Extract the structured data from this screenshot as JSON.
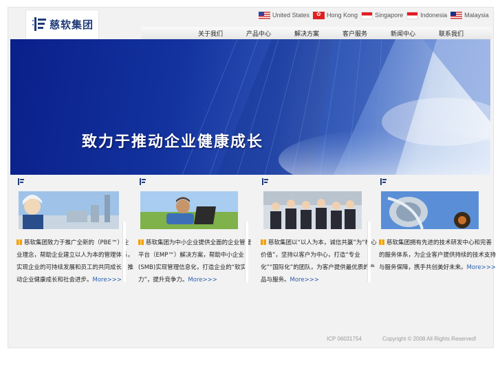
{
  "header": {
    "logo_text": "慈软集团",
    "countries": [
      {
        "label": "United States",
        "flag": "us-flag-icon"
      },
      {
        "label": "Hong Kong",
        "flag": "hk-flag-icon"
      },
      {
        "label": "Singapore",
        "flag": "sg-flag-icon"
      },
      {
        "label": "Indonesia",
        "flag": "id-flag-icon"
      },
      {
        "label": "Malaysia",
        "flag": "my-flag-icon"
      }
    ]
  },
  "nav": {
    "items": [
      "关于我们",
      "产品中心",
      "解决方案",
      "客户服务",
      "新闻中心",
      "联系我们"
    ]
  },
  "banner": {
    "slogan": "致力于推动企业健康成长"
  },
  "columns": [
    {
      "text": "慈软集团致力于推广全新的（PBE™）企业理念，帮助企业建立以人为本的管理体系，实现企业的可持续发展和员工的共同成长，推动企业健康成长和社会进步。",
      "more": "More>>>"
    },
    {
      "text": "慈软集团为中小企业提供全面的企业管理平台（EMP™）解决方案，帮助中小企业(SMB)实现管理信息化，打造企业的“软实力”，提升竞争力。",
      "more": "More>>>"
    },
    {
      "text": "慈软集团以“以人为本，诚信共赢”为“核心价值”，坚持以客户为中心，打造“专业化”“国际化”的团队，为客户提供最优质的产品与服务。",
      "more": "More>>>"
    },
    {
      "text": "慈软集团拥有先进的技术研发中心和完善的服务体系，为企业客户提供持续的技术支持与服务保障，携手共创美好未来。",
      "more": "More>>>"
    }
  ],
  "footer": {
    "icp": "ICP 06031754",
    "copyright": "Copyright © 2008 All Rights Reserved!"
  }
}
